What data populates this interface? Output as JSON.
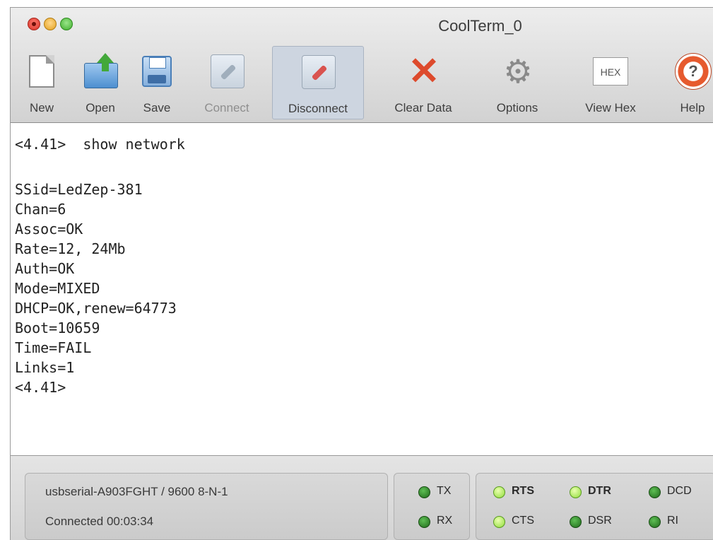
{
  "window": {
    "title": "CoolTerm_0"
  },
  "toolbar": {
    "new": "New",
    "open": "Open",
    "save": "Save",
    "connect": "Connect",
    "disconnect": "Disconnect",
    "clear_data": "Clear Data",
    "options": "Options",
    "view_hex": "View Hex",
    "hex_icon_text": "HEX",
    "help": "Help"
  },
  "terminal": {
    "lines": [
      "<4.41>  show network",
      "",
      "SSid=LedZep-381",
      "Chan=6",
      "Assoc=OK",
      "Rate=12, 24Mb",
      "Auth=OK",
      "Mode=MIXED",
      "DHCP=OK,renew=64773",
      "Boot=10659",
      "Time=FAIL",
      "Links=1",
      "<4.41>"
    ]
  },
  "status": {
    "port_info": "usbserial-A903FGHT / 9600 8-N-1",
    "connection": "Connected 00:03:34",
    "tx": "TX",
    "rx": "RX",
    "rts": "RTS",
    "cts": "CTS",
    "dtr": "DTR",
    "dsr": "DSR",
    "dcd": "DCD",
    "ri": "RI"
  },
  "colors": {
    "led_dark": "#2f8a26",
    "led_bright": "#a6e24a",
    "clear_x": "#dd4a2c"
  }
}
